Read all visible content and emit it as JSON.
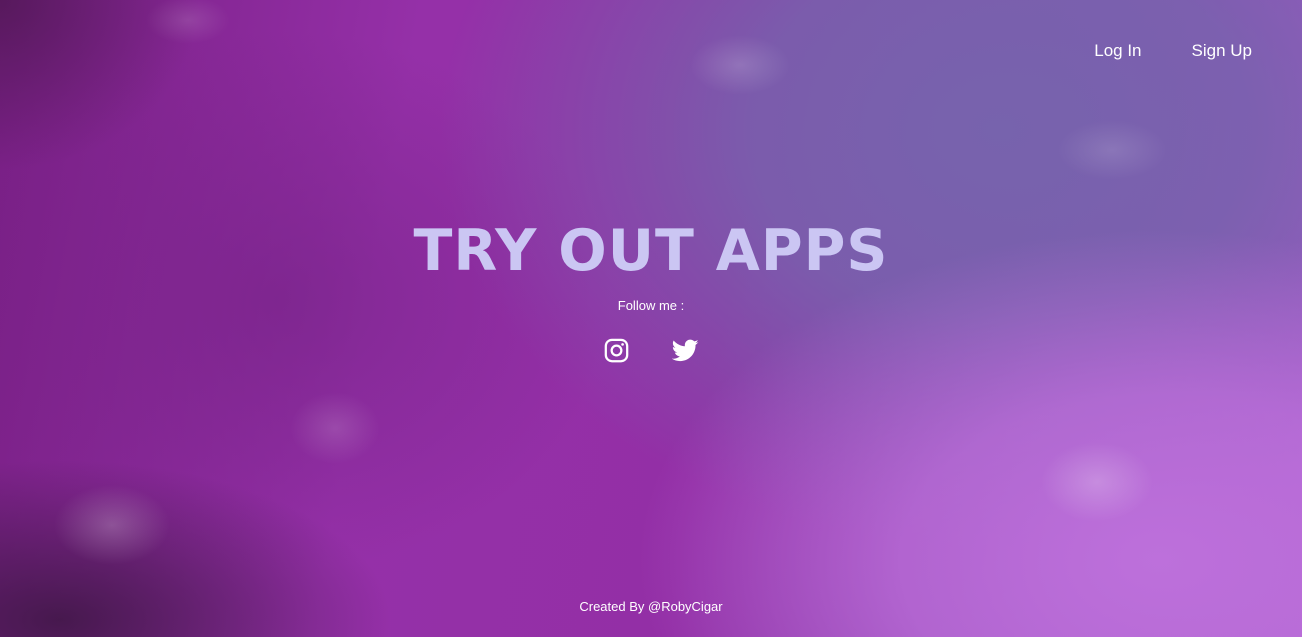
{
  "nav": {
    "login_label": "Log In",
    "signup_label": "Sign Up"
  },
  "hero": {
    "title": "TRY OUT APPS",
    "follow_text": "Follow me :"
  },
  "social": {
    "icons": [
      "instagram-icon",
      "twitter-icon"
    ]
  },
  "footer": {
    "credit": "Created By @RobyCigar"
  },
  "colors": {
    "title": "#cbc6f3",
    "text": "#ffffff",
    "background_primary": "#9530a8",
    "background_secondary": "#7763ad",
    "background_accent": "#bd70db"
  }
}
